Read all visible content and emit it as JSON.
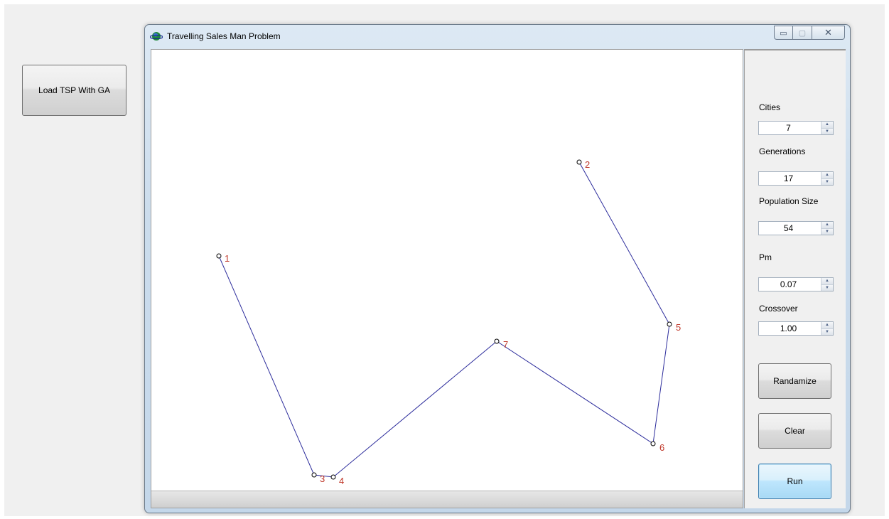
{
  "left_button": {
    "label": "Load TSP With GA"
  },
  "window": {
    "title": "Travelling Sales Man Problem",
    "icon": "globe-icon",
    "controls": {
      "minimize": "minimize-icon",
      "maximize": "maximize-icon",
      "close": "close-icon"
    }
  },
  "tour": {
    "line_color": "#2d2d9c",
    "label_color": "#c0392b",
    "cities": [
      {
        "label": "1"
      },
      {
        "label": "2"
      },
      {
        "label": "3"
      },
      {
        "label": "4"
      },
      {
        "label": "5"
      },
      {
        "label": "6"
      },
      {
        "label": "7"
      }
    ]
  },
  "panel": {
    "fields": [
      {
        "label": "Cities",
        "value": "7"
      },
      {
        "label": "Generations",
        "value": "17"
      },
      {
        "label": "Population Size",
        "value": "54"
      },
      {
        "label": "Pm",
        "value": "0.07"
      },
      {
        "label": "Crossover",
        "value": "1.00"
      }
    ],
    "buttons": {
      "randomize": "Randamize",
      "clear": "Clear",
      "run": "Run"
    }
  }
}
